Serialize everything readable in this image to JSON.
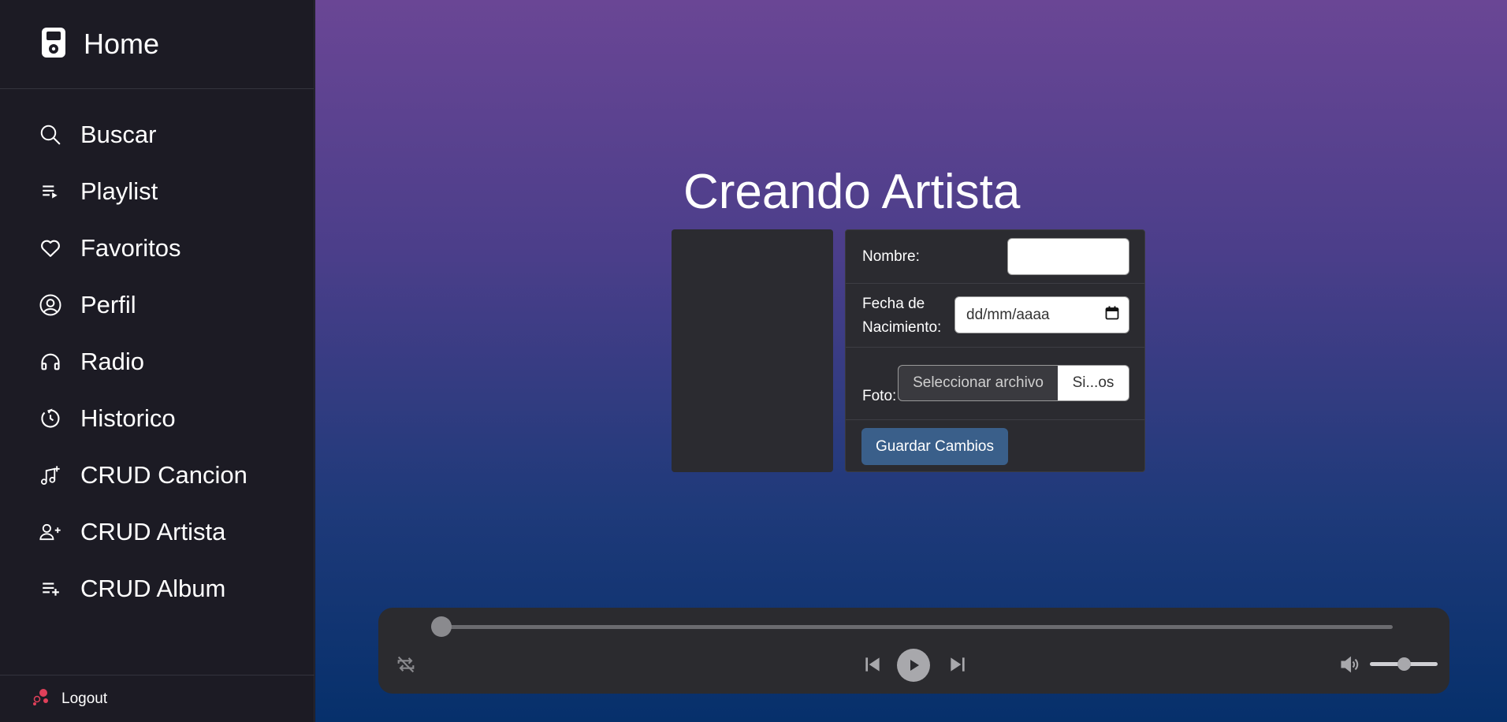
{
  "sidebar": {
    "home_label": "Home",
    "items": [
      {
        "label": "Buscar",
        "icon": "search-icon"
      },
      {
        "label": "Playlist",
        "icon": "playlist-icon"
      },
      {
        "label": "Favoritos",
        "icon": "heart-icon"
      },
      {
        "label": "Perfil",
        "icon": "user-circle-icon"
      },
      {
        "label": "Radio",
        "icon": "headphones-icon"
      },
      {
        "label": "Historico",
        "icon": "history-icon"
      },
      {
        "label": "CRUD Cancion",
        "icon": "music-plus-icon"
      },
      {
        "label": "CRUD Artista",
        "icon": "user-plus-icon"
      },
      {
        "label": "CRUD Album",
        "icon": "list-plus-icon"
      }
    ],
    "logout_label": "Logout"
  },
  "main": {
    "title": "Creando Artista",
    "form": {
      "nombre_label": "Nombre:",
      "nombre_value": "",
      "fecha_label_line1": "Fecha de",
      "fecha_label_line2": "Nacimiento:",
      "fecha_placeholder": "dd/mm/aaaa",
      "foto_label": "Foto:",
      "file_button_label": "Seleccionar archivo",
      "file_name": "Si...os",
      "save_label": "Guardar Cambios"
    }
  },
  "player": {
    "progress": 0,
    "volume": 0.5
  },
  "colors": {
    "sidebar_bg": "#1c1b24",
    "gradient_top": "#6a4695",
    "gradient_bottom": "#06306b",
    "card_bg": "#2b2b30",
    "save_button": "#3a5f8a",
    "logout_accent": "#e0405a"
  }
}
